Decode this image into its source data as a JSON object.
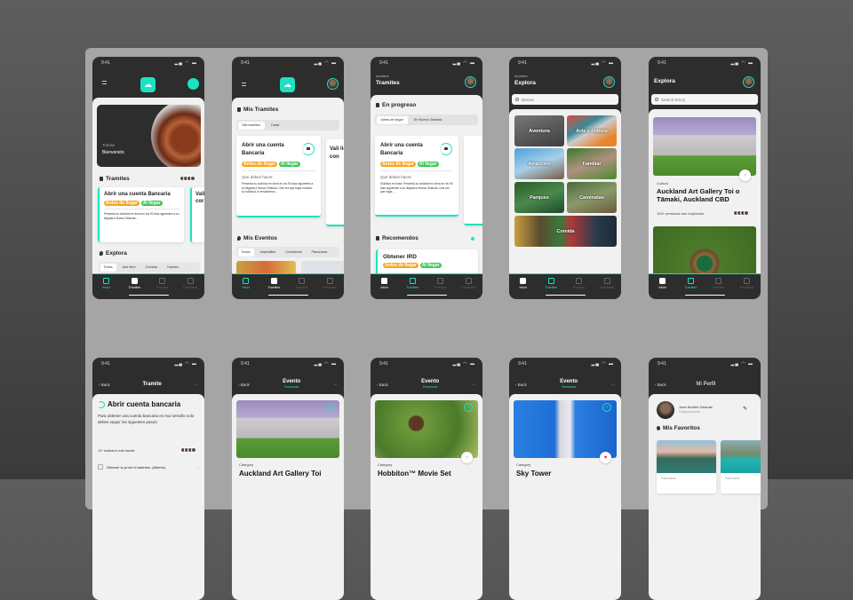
{
  "status_time": "9:41",
  "status_icons": "signal wifi battery",
  "nav": [
    "Inicio",
    "Tramites",
    "Eventos",
    "Feedback"
  ],
  "tags": {
    "before": "Antes de llegar",
    "arrival": "Al llegar"
  },
  "colors": {
    "accent": "#19e3c4",
    "dark": "#2d2d2d",
    "tag_orange": "#f5a623",
    "tag_green": "#4cd964"
  },
  "home": {
    "hero_label": "Tramite",
    "hero_title": "Bienvenido",
    "tramites_heading": "Tramites",
    "card1_title": "Abrir una cuenta Bancaria",
    "card1_desc": "Presenta su solicitud en línea en los 90 días siguientes a su llegada a Nueva Zelanda...",
    "card2_title": "Vali cor",
    "explora_heading": "Explora",
    "explora_tabs": [
      "Todos",
      "Aire libre",
      "Comida",
      "Turismo"
    ]
  },
  "mis_tramites": {
    "heading": "Mis Tramites",
    "segments": [
      "Mis tramites",
      "Crear"
    ],
    "card_title": "Abrir una cuenta Bancaria",
    "card_subhead": "Que debes hacer:",
    "card_desc": "Presenta su solicitud en línea en los 90 días siguientes a su llegada a Nueva Zelanda. Una vez que haya enviado su solicitud, le enviaremos...",
    "card2_title": "Vali licen con",
    "eventos_heading": "Mis Eventos",
    "eventos_tabs": [
      "Todos",
      "Imperdible",
      "Conciertos",
      "Panorama"
    ]
  },
  "tramites": {
    "location": "Auckland",
    "title": "Tramites",
    "progress_heading": "En progreso",
    "segments": [
      "Antes de llegar",
      "En Nueva Zelanda"
    ],
    "card_title": "Abrir una cuenta Bancaria",
    "card_subhead": "Que debes hacer:",
    "card_desc": "Solicitud en línea. Presenta su solicitud en línea en los 90 días siguientes a su llegada a Nueva Zelanda. Una vez que haya...",
    "recommend_heading": "Recomendos",
    "recommend_card": "Obtener IRD"
  },
  "explora": {
    "location": "Auckland",
    "title": "Explora",
    "search_placeholder": "Buscar",
    "categories": [
      "Aventura",
      "Arte y cultura",
      "Atraccion",
      "Familiar",
      "Parques",
      "Caminatas",
      "Comida"
    ]
  },
  "explora2": {
    "title": "Explora",
    "search_placeholder": "Search Emoji",
    "category": "Cultura",
    "place_title": "Auckland Art Gallery Toi o Tāmaki, Auckland CBD",
    "explored": "100+ personas han explorado"
  },
  "tramite_detail": {
    "back": "Back",
    "title": "Tramite",
    "more": "···",
    "heading": "Abrir cuenta bancaria",
    "intro": "Para obtener una cuenta bancaria es mui sencillo solo debes seguir los siguentes pasos:",
    "count": "10+ realizaron este tramite",
    "step1": "Obtener tu proof of address. (Abierto)"
  },
  "eventos": [
    {
      "back": "Back",
      "title": "Evento",
      "subtitle": "Panoramas",
      "more": "···",
      "category": "Category",
      "name": "Auckland Art Gallery Toi"
    },
    {
      "back": "Back",
      "title": "Evento",
      "subtitle": "Panoramas",
      "more": "···",
      "category": "Category",
      "name": "Hobbiton™ Movie Set"
    },
    {
      "back": "Back",
      "title": "Evento",
      "subtitle": "Panoramas",
      "more": "···",
      "category": "Category",
      "name": "Sky Tower"
    }
  ],
  "perfil": {
    "back": "Back",
    "title": "Mi Perfil",
    "user_name": "Juan Andrés Solanas",
    "user_role": "Chapocorrector",
    "favorites_heading": "Mis Favoritos",
    "fav_labels": [
      "Panorama",
      "Panorama"
    ]
  }
}
